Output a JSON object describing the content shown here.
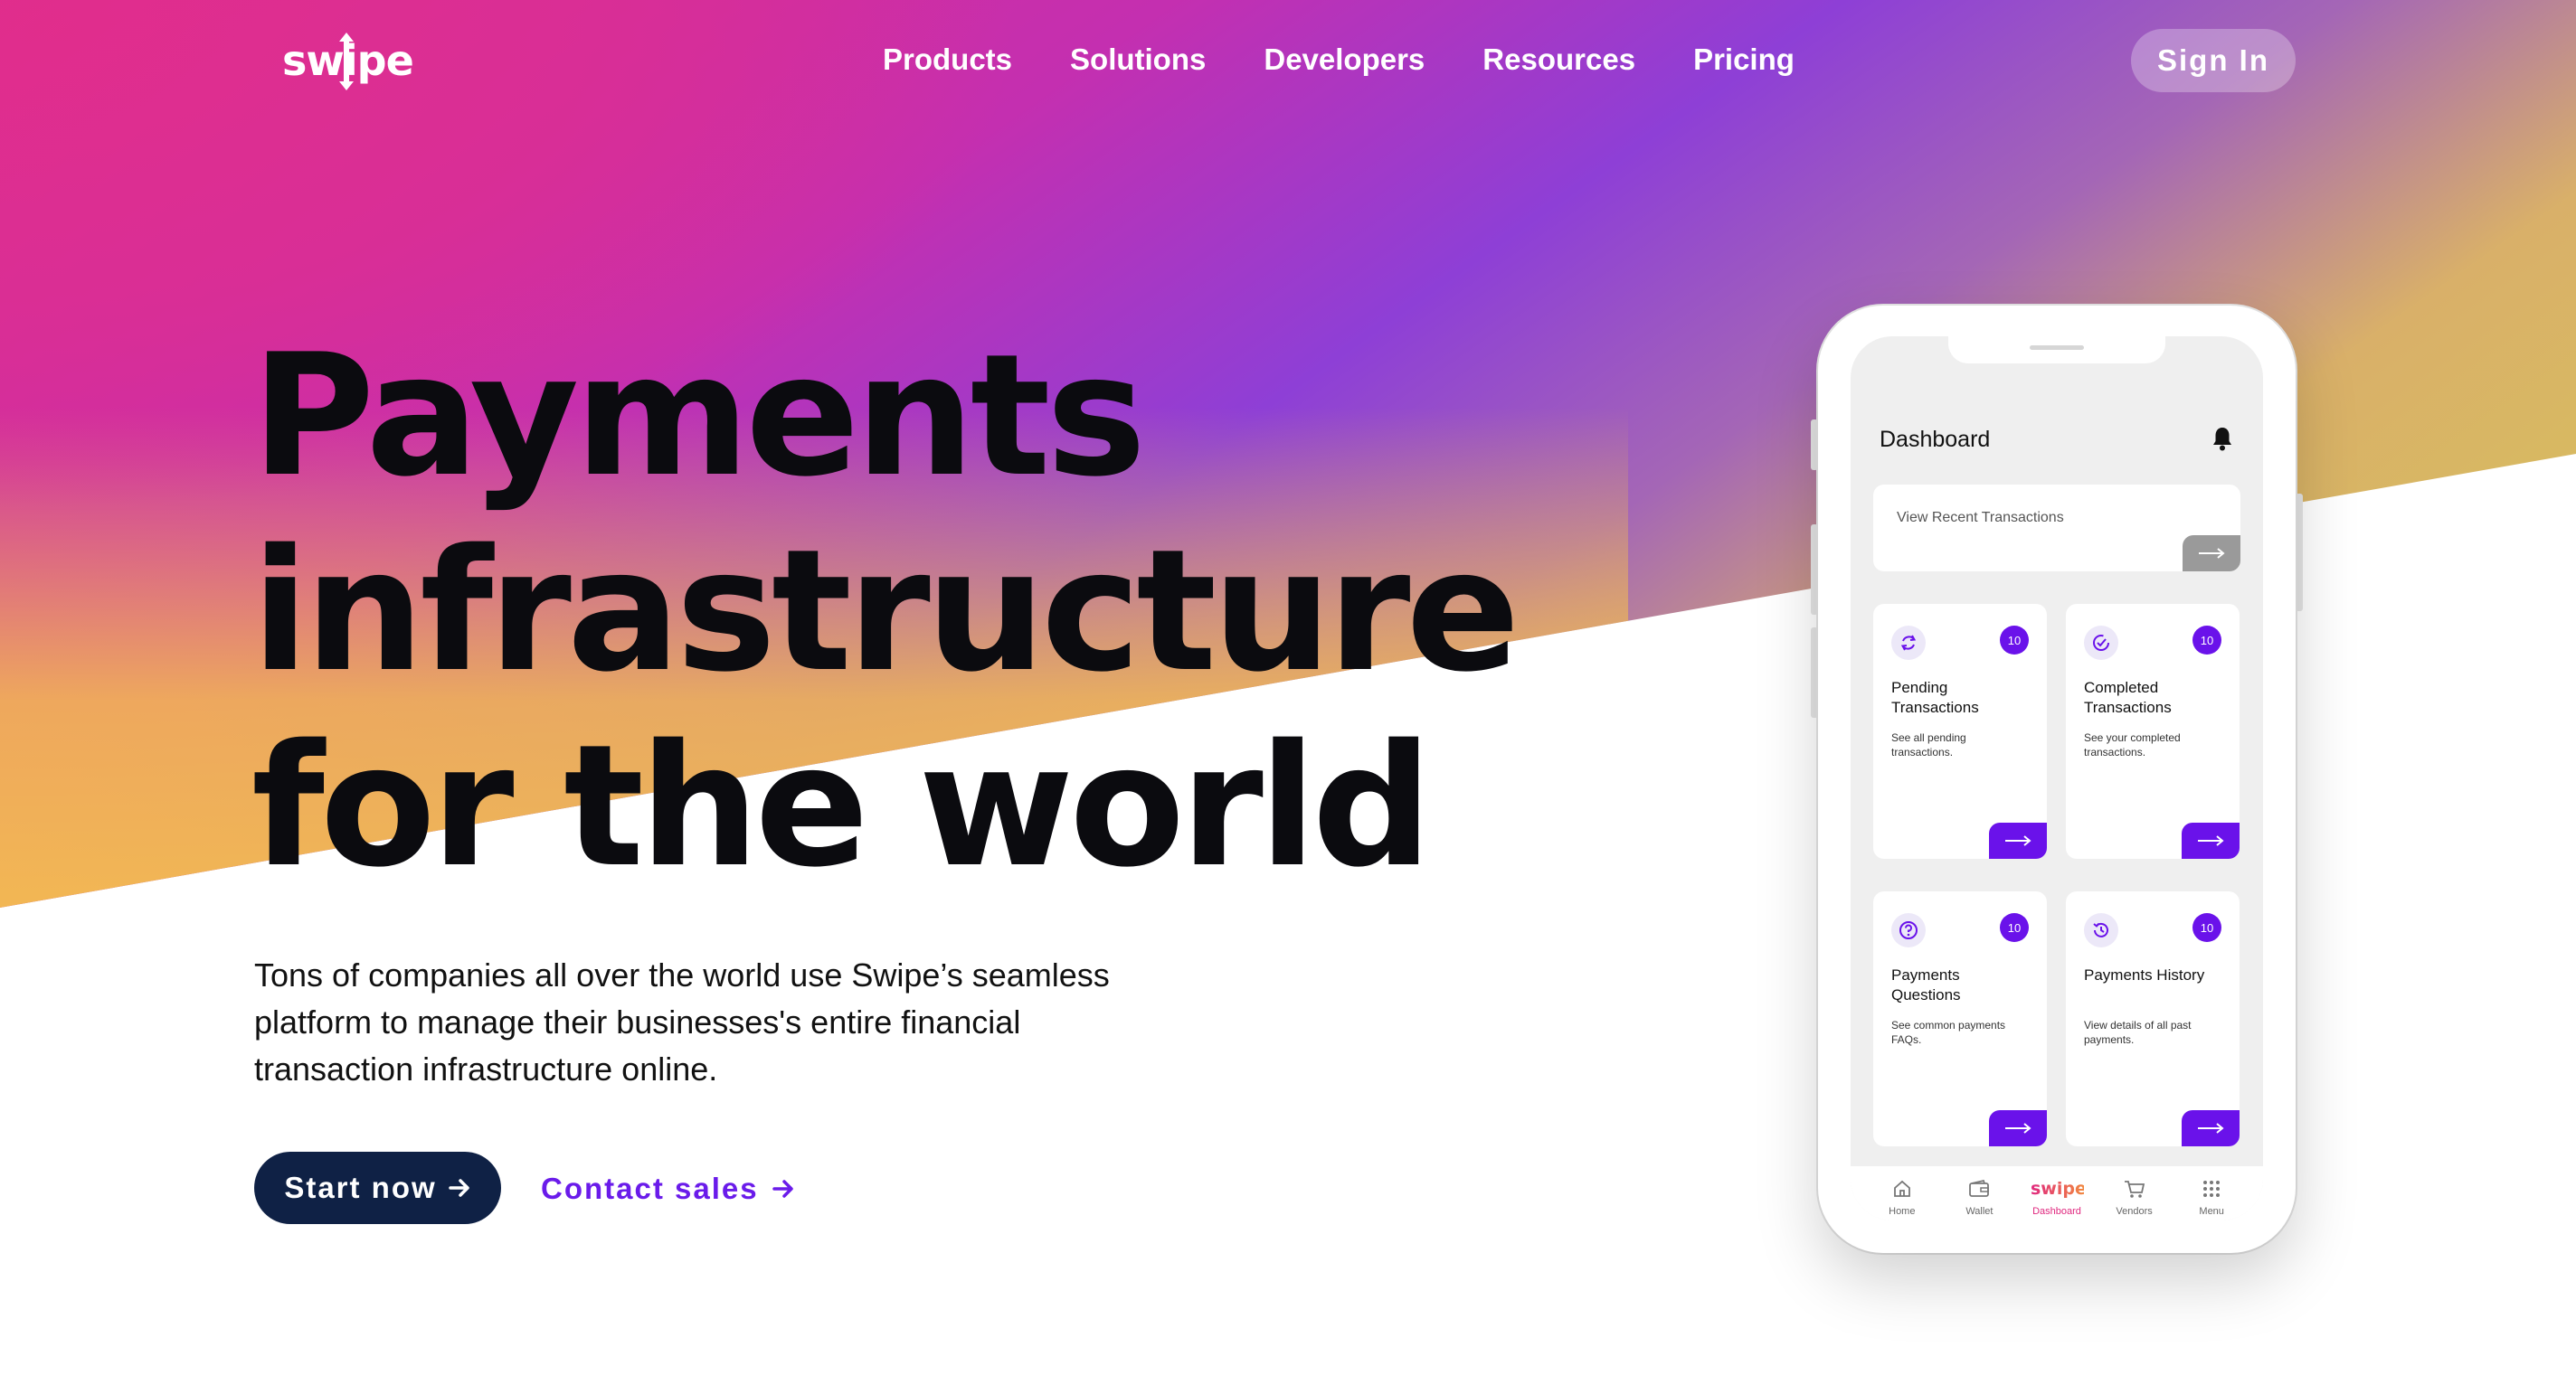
{
  "brand": {
    "logo_text": "swipe"
  },
  "nav": {
    "links": [
      "Products",
      "Solutions",
      "Developers",
      "Resources",
      "Pricing"
    ],
    "signin_label": "Sign In"
  },
  "hero": {
    "title_lines": [
      "Payments",
      "infrastructure",
      "for the world"
    ],
    "subtitle": "Tons of companies all over the world use Swipe’s seamless platform to manage their businesses's entire financial transaction infrastructure online.",
    "primary_cta": "Start now",
    "secondary_cta": "Contact sales"
  },
  "phone": {
    "dashboard_title": "Dashboard",
    "recent_transactions_label": "View Recent Transactions",
    "tiles": [
      {
        "title": "Pending Transactions",
        "description": "See all pending transactions.",
        "badge": "10",
        "icon": "refresh-icon"
      },
      {
        "title": "Completed Transactions",
        "description": "See your completed transactions.",
        "badge": "10",
        "icon": "check-circle-icon"
      },
      {
        "title": "Payments Questions",
        "description": "See common payments FAQs.",
        "badge": "10",
        "icon": "question-icon"
      },
      {
        "title": "Payments History",
        "description": "View details of all past payments.",
        "badge": "10",
        "icon": "history-icon"
      }
    ],
    "bottom_nav": [
      {
        "label": "Home",
        "icon": "home-icon"
      },
      {
        "label": "Wallet",
        "icon": "wallet-icon"
      },
      {
        "label": "Dashboard",
        "icon": "swipe-logo",
        "active": true
      },
      {
        "label": "Vendors",
        "icon": "cart-icon"
      },
      {
        "label": "Menu",
        "icon": "grid-icon"
      }
    ]
  },
  "colors": {
    "pink": "#e02d8c",
    "purple": "#8a3fd6",
    "yellow": "#f4bd4f",
    "accent": "#6a12ea",
    "navy": "#0f2145"
  }
}
